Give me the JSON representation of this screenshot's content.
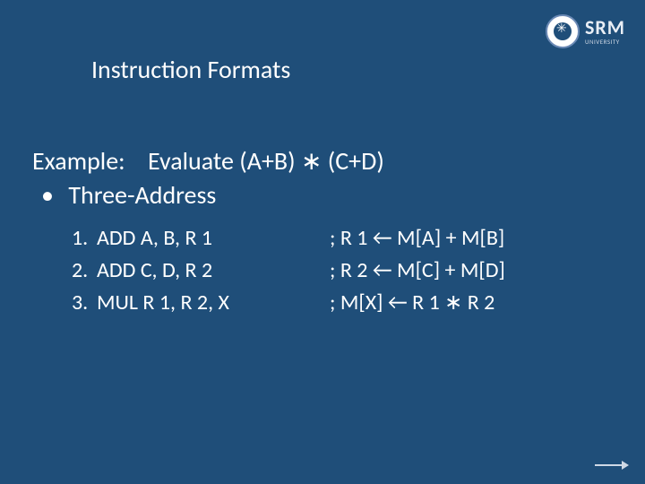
{
  "logo": {
    "name": "SRM",
    "subtitle": "UNIVERSITY"
  },
  "title": "Instruction Formats",
  "example_label": "Example:",
  "example_expr": "Evaluate (A+B) ∗ (C+D)",
  "bullet": "•",
  "subtopic": "Three-Address",
  "lines": [
    {
      "num": "1.",
      "instr": "ADD A, B, R 1",
      "comment": "; R 1 ← M[A] + M[B]"
    },
    {
      "num": "2.",
      "instr": "ADD C, D, R 2",
      "comment": "; R 2 ← M[C] + M[D]"
    },
    {
      "num": "3.",
      "instr": "MUL R 1, R 2, X",
      "comment": "; M[X] ← R 1 ∗ R 2"
    }
  ]
}
